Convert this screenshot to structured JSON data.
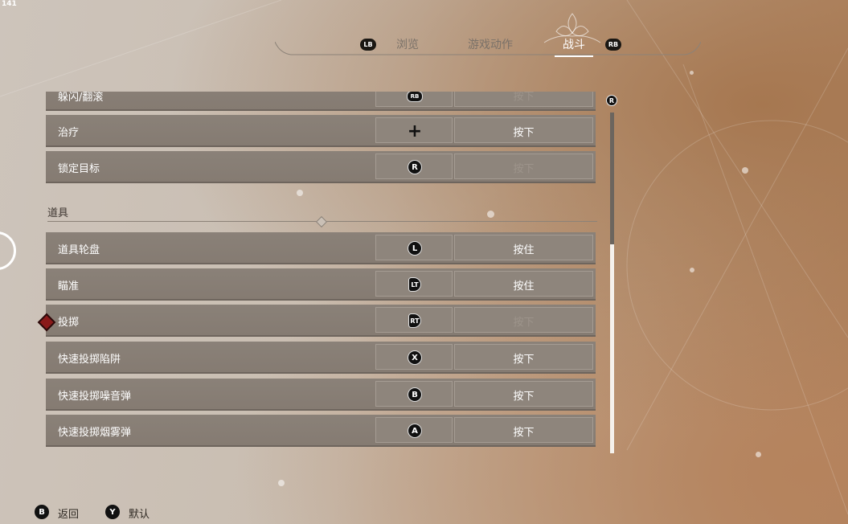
{
  "overlay": {
    "fps": "141"
  },
  "header": {
    "lb_label": "LB",
    "rb_label": "RB",
    "tabs": [
      {
        "label": "浏览",
        "active": false
      },
      {
        "label": "游戏动作",
        "active": false
      },
      {
        "label": "战斗",
        "active": true
      }
    ]
  },
  "rows": [
    {
      "label": "躲闪/翻滚",
      "input": "RB",
      "action": "按下",
      "dim": true
    },
    {
      "label": "治疗",
      "input": "+",
      "action": "按下",
      "dim": false
    },
    {
      "label": "锁定目标",
      "input": "R",
      "action": "按下",
      "dim": true
    }
  ],
  "section": {
    "title": "道具"
  },
  "item_rows": [
    {
      "label": "道具轮盘",
      "input": "L",
      "action": "按住",
      "dim": false
    },
    {
      "label": "瞄准",
      "input": "LT",
      "action": "按住",
      "dim": false
    },
    {
      "label": "投掷",
      "input": "RT",
      "action": "按下",
      "dim": true
    },
    {
      "label": "快速投掷陷阱",
      "input": "X",
      "action": "按下",
      "dim": false
    },
    {
      "label": "快速投掷噪音弹",
      "input": "B",
      "action": "按下",
      "dim": false
    },
    {
      "label": "快速投掷烟雾弹",
      "input": "A",
      "action": "按下",
      "dim": false
    }
  ],
  "scrollbar": {
    "icon": "R"
  },
  "footer": {
    "back_button": "B",
    "back_label": "返回",
    "default_button": "Y",
    "default_label": "默认"
  },
  "colors": {
    "accent": "#ffffff",
    "row_bg": "#857b72",
    "text_dim": "#9d948b"
  }
}
